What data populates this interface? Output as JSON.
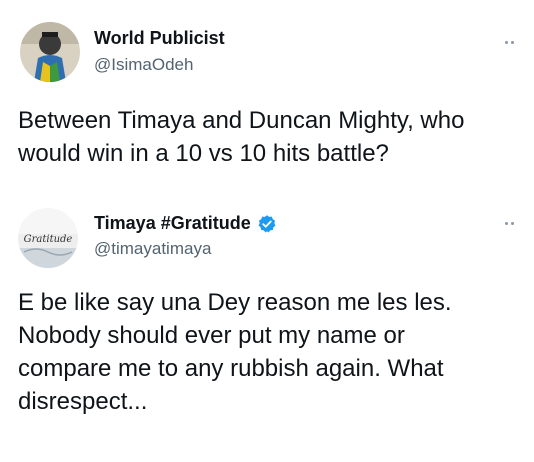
{
  "colors": {
    "text_primary": "#0f1419",
    "text_secondary": "#536471",
    "verified_blue": "#1d9bf0",
    "more_dots": "#8b98a5"
  },
  "tweets": [
    {
      "display_name": "World Publicist",
      "handle": "@IsimaOdeh",
      "verified": false,
      "avatar": "avatar-illustration",
      "more_icon": "more-dots-icon",
      "body": "Between Timaya and Duncan Mighty, who\nwould win in a 10 vs 10 hits battle?"
    },
    {
      "display_name": "Timaya #Gratitude",
      "handle": "@timayatimaya",
      "verified": true,
      "avatar": "avatar-gratitude-logo",
      "avatar_text": "Gratitude",
      "more_icon": "more-dots-icon",
      "body": "E be like say una Dey reason me les les.\nNobody should ever put my name or\ncompare me to any rubbish again. What\ndisrespect..."
    }
  ]
}
